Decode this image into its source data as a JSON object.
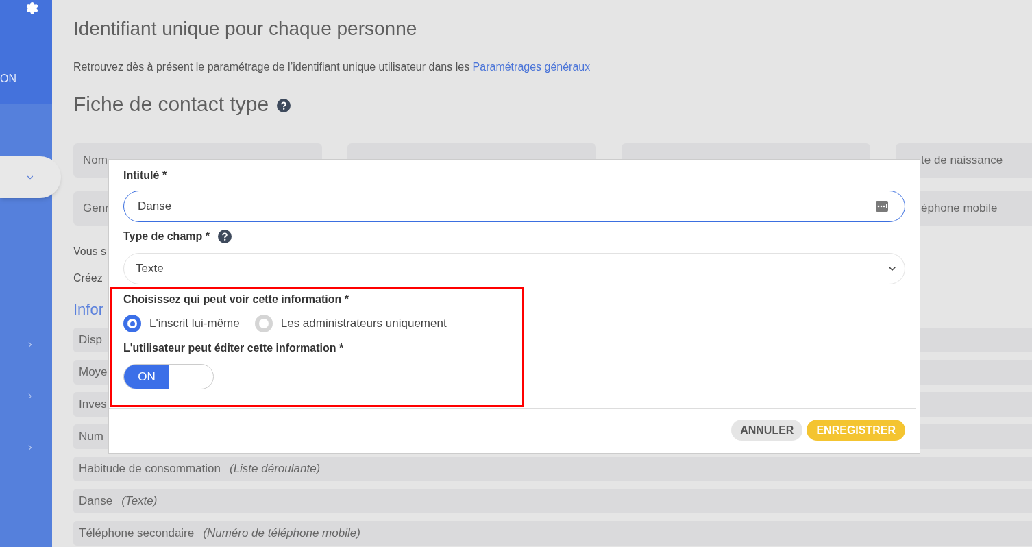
{
  "sidebar": {
    "label": "ON",
    "items": [
      {
        "kind": "pill",
        "expanded": false
      },
      {
        "kind": "item",
        "expanded": false
      },
      {
        "kind": "item",
        "expanded": false
      },
      {
        "kind": "item",
        "expanded": false
      }
    ]
  },
  "header": {
    "title": "Identifiant unique pour chaque personne",
    "intro": "Retrouvez dès à présent le paramétrage de l’identifiant unique utilisateur dans les",
    "intro_link": "Paramétrages généraux",
    "section_title": "Fiche de contact type"
  },
  "contact_fields": [
    {
      "kind": "field",
      "label": "Nom"
    },
    {
      "kind": "covered"
    },
    {
      "kind": "covered"
    },
    {
      "kind": "cut",
      "label": "te de naissance"
    },
    {
      "kind": "field",
      "label": "Genr"
    },
    {
      "kind": "cut",
      "label": "éphone mobile"
    }
  ],
  "notes": [
    "Vous s",
    "Créez"
  ],
  "info_title": "Infor",
  "info_fields": [
    {
      "name": "Disp"
    },
    {
      "name": "Moye"
    },
    {
      "name": "Inves"
    },
    {
      "name": "Num"
    },
    {
      "name": "Habitude de consommation",
      "type": "(Liste déroulante)"
    },
    {
      "name": "Danse",
      "type": "(Texte)"
    },
    {
      "name": "Téléphone secondaire",
      "type": "(Numéro de téléphone mobile)"
    }
  ],
  "dialog": {
    "title_label": "Intitulé *",
    "title_value": "Danse",
    "type_label": "Type de champ *",
    "type_value": "Texte",
    "visibility_label": "Choisissez qui peut voir cette information *",
    "visibility_options": [
      {
        "label": "L'inscrit lui-même",
        "selected": true
      },
      {
        "label": "Les administrateurs uniquement",
        "selected": false
      }
    ],
    "edit_label": "L'utilisateur peut éditer cette information *",
    "edit_toggle": {
      "on": true,
      "label": "ON"
    },
    "cancel": "ANNULER",
    "save": "ENREGISTRER"
  }
}
